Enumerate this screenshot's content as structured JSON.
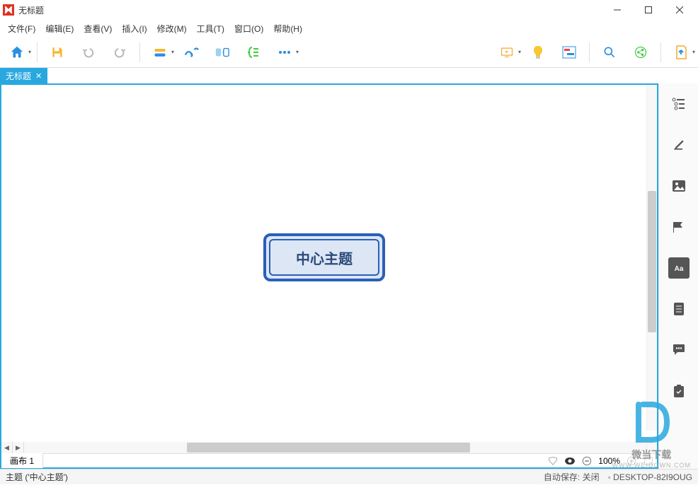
{
  "window": {
    "title": "无标题"
  },
  "menus": {
    "file": "文件(F)",
    "edit": "编辑(E)",
    "view": "查看(V)",
    "insert": "插入(I)",
    "modify": "修改(M)",
    "tools": "工具(T)",
    "window": "窗口(O)",
    "help": "帮助(H)"
  },
  "tab": {
    "label": "无标题"
  },
  "canvas": {
    "central_topic": "中心主题"
  },
  "sheet": {
    "label": "画布 1"
  },
  "zoom": {
    "value": "100%"
  },
  "status": {
    "topic": "主题 ('中心主题')",
    "autosave": "自动保存: 关闭",
    "computer": "DESKTOP-82I9OUG"
  },
  "watermark": {
    "text": "微当下载",
    "url": "WWW.WEIDOWN.COM"
  }
}
